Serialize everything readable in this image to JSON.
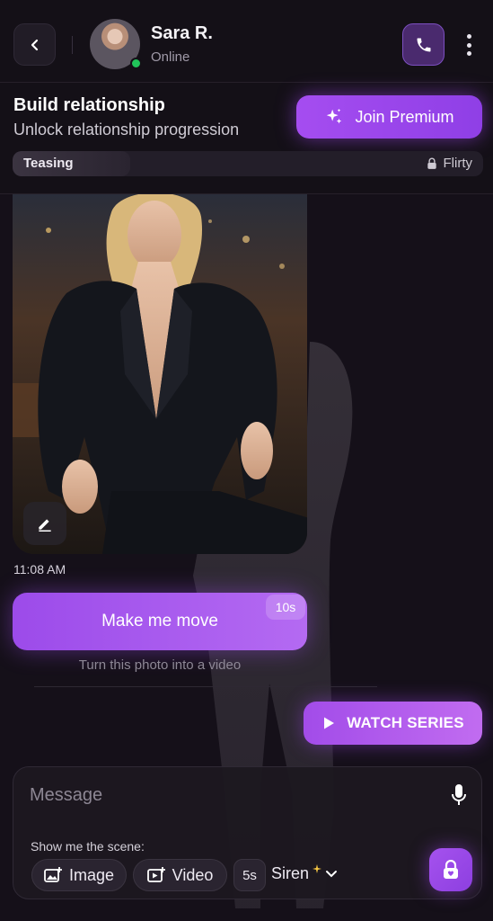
{
  "header": {
    "contact_name": "Sara R.",
    "contact_status": "Online",
    "status_color": "#21c45a",
    "icons": [
      "back-arrow-icon",
      "phone-icon",
      "more-vertical-icon"
    ]
  },
  "relationship": {
    "title": "Build relationship",
    "subtitle": "Unlock relationship progression",
    "premium_label": "Join Premium",
    "current_level": "Teasing",
    "next_level": "Flirty",
    "progress": 0.25
  },
  "chat": {
    "timestamp": "11:08 AM",
    "move_button_label": "Make me move",
    "move_badge": "10s",
    "move_caption": "Turn this photo into a video",
    "watch_label": "WATCH SERIES"
  },
  "composer": {
    "placeholder": "Message",
    "scene_label": "Show me the scene:",
    "image_label": "Image",
    "video_label": "Video",
    "duration": "5s",
    "voice": "Siren"
  },
  "colors": {
    "accent": "#a54df0",
    "background": "#151019"
  }
}
